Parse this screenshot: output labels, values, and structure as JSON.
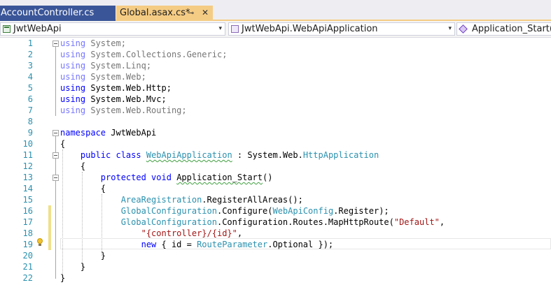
{
  "tabs": [
    {
      "label": "AccountController.cs",
      "active": false
    },
    {
      "label": "Global.asax.cs*",
      "active": true,
      "pin_glyph": "⊸",
      "close_glyph": "✕"
    }
  ],
  "nav": {
    "project": "JwtWebApi",
    "class": "JwtWebApi.WebApiApplication",
    "method": "Application_Start()"
  },
  "icons": {
    "project": "csharp-project-icon",
    "class": "class-icon",
    "method": "method-cube-icon",
    "lightbulb": "lightbulb-icon",
    "dropdown": "▾"
  },
  "editor": {
    "line_numbers": [
      "1",
      "2",
      "3",
      "4",
      "5",
      "6",
      "7",
      "8",
      "9",
      "10",
      "11",
      "12",
      "13",
      "14",
      "15",
      "16",
      "17",
      "18",
      "19",
      "20",
      "21",
      "22"
    ],
    "code": {
      "l1_kw": "using",
      "l1_rest": " System;",
      "l2_kw": "using",
      "l2_rest": " System.Collections.Generic;",
      "l3_kw": "using",
      "l3_rest": " System.Linq;",
      "l4_kw": "using",
      "l4_rest": " System.Web;",
      "l5_kw": "using",
      "l5_rest": " System.Web.Http;",
      "l6_kw": "using",
      "l6_rest": " System.Web.Mvc;",
      "l7_kw": "using",
      "l7_rest": " System.Web.Routing;",
      "l9_kw": "namespace",
      "l9_rest": " JwtWebApi",
      "l10": "{",
      "l11_kw": "public class",
      "l11_ty": "WebApiApplication",
      "l11_mid": " : System.Web.",
      "l11_ty2": "HttpApplication",
      "l12": "{",
      "l13_kw": "protected void",
      "l13_name": "Application_Start",
      "l13_rest": "()",
      "l14": "{",
      "l15_ty": "AreaRegistration",
      "l15_rest": ".RegisterAllAreas();",
      "l16_ty": "GlobalConfiguration",
      "l16_a": ".Configure(",
      "l16_ty2": "WebApiConfig",
      "l16_b": ".Register);",
      "l17_ty": "GlobalConfiguration",
      "l17_a": ".Configuration.Routes.MapHttpRoute(",
      "l17_str": "\"Default\"",
      "l17_b": ",",
      "l18_str": "\"{controller}/{id}\"",
      "l18_b": ",",
      "l19_kw": "new",
      "l19_a": " { id = ",
      "l19_ty": "RouteParameter",
      "l19_b": ".Optional });",
      "l20": "}",
      "l21": "}",
      "l22": "}"
    }
  },
  "colors": {
    "keyword": "#0000ff",
    "type": "#2b91af",
    "string": "#a31515",
    "active_tab": "#f5cc84",
    "inactive_tab": "#3a5598"
  }
}
